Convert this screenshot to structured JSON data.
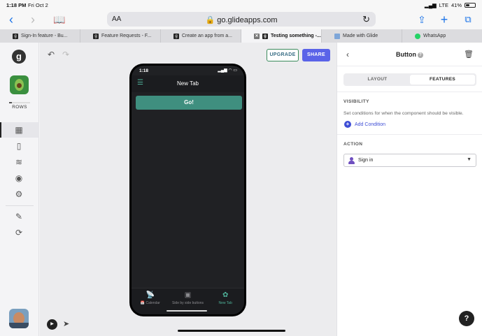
{
  "status_bar": {
    "time": "1:18 PM",
    "date": "Fri Oct 2",
    "network": "LTE",
    "battery": "41%"
  },
  "browser": {
    "text_size_label": "AA",
    "url": "go.glideapps.com",
    "tabs": [
      {
        "label": "Sign-In feature - Bu...",
        "favicon": "g"
      },
      {
        "label": "Feature Requests - F...",
        "favicon": "g"
      },
      {
        "label": "Create an app from a...",
        "favicon": "g"
      },
      {
        "label": "Testing something -...",
        "favicon": "g",
        "active": true
      },
      {
        "label": "Made with Glide",
        "favicon": ""
      },
      {
        "label": "WhatsApp",
        "favicon": ""
      }
    ],
    "icons": [
      "back-icon",
      "forward-icon",
      "bookmarks-icon",
      "share-icon",
      "new-tab-icon",
      "tabs-overview-icon"
    ]
  },
  "sidebar": {
    "logo": "g",
    "rows_label": "ROWS",
    "rows_usage": 0.12,
    "items": [
      "layout-icon",
      "phone-icon",
      "database-icon",
      "users-icon",
      "settings-icon",
      "edit-icon",
      "sync-icon"
    ]
  },
  "toolbar": {
    "upgrade_label": "UPGRADE",
    "share_label": "SHARE"
  },
  "phone": {
    "time": "1:18",
    "header_title": "New Tab",
    "button_label": "Go!",
    "tabs": [
      {
        "label": "Calendar",
        "icon": "calendar-icon"
      },
      {
        "label": "Side by side buttons",
        "icon": "image-icon"
      },
      {
        "label": "New Tab",
        "icon": "new-tab-app-icon",
        "active": true
      }
    ]
  },
  "panel": {
    "title": "Button",
    "segments": {
      "layout": "LAYOUT",
      "features": "FEATURES"
    },
    "visibility_heading": "VISIBILITY",
    "visibility_desc": "Set conditions for when the component should be visible.",
    "add_condition": "Add Condition",
    "action_heading": "ACTION",
    "action_value": "Sign in"
  },
  "colors": {
    "accent": "#5a63e8",
    "go_button": "#3f8f7f",
    "link": "#3e4ed6"
  }
}
